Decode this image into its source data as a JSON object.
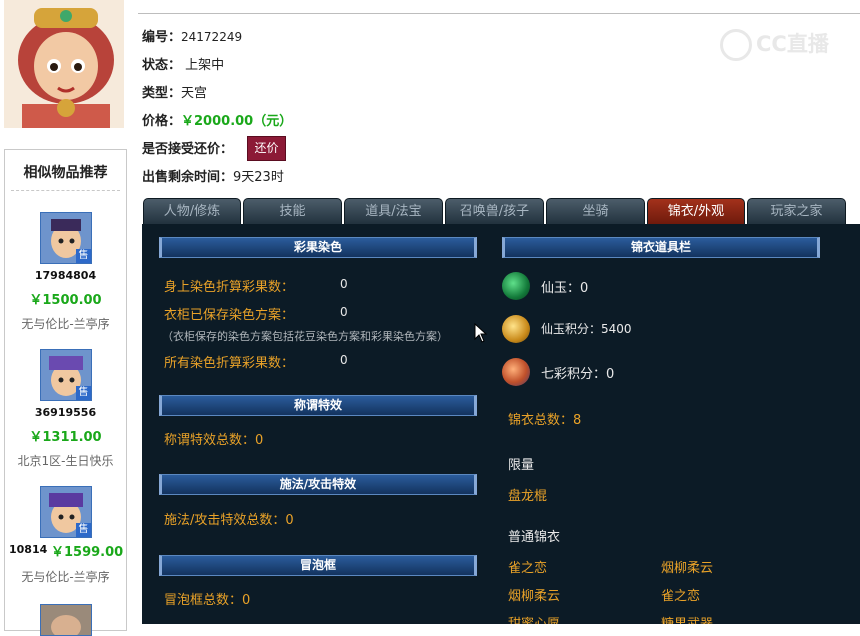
{
  "item": {
    "id_label": "编号：",
    "id": "24172249",
    "status_label": "状态：",
    "status": "上架中",
    "type_label": "类型：",
    "type": "天宫",
    "price_label": "价格：",
    "price": "￥2000.00（元）",
    "bargain_label": "是否接受还价：",
    "bargain_button": "还价",
    "remaining_label": "出售剩余时间：",
    "remaining": "9天23时"
  },
  "watermark": "CC直播",
  "similar": {
    "title": "相似物品推荐",
    "sell_badge": "售",
    "items": [
      {
        "id": "17984804",
        "price": "￥1500.00",
        "server": "无与伦比-兰亭序"
      },
      {
        "id": "36919556",
        "price": "￥1311.00",
        "server": "北京1区-生日快乐"
      },
      {
        "id": "10814",
        "price": "￥1599.00",
        "server": "无与伦比-兰亭序"
      }
    ]
  },
  "tabs": [
    "人物/修炼",
    "技能",
    "道具/法宝",
    "召唤兽/孩子",
    "坐骑",
    "锦衣/外观",
    "玩家之家"
  ],
  "active_tab": "锦衣/外观",
  "dye": {
    "header": "彩果染色",
    "body_label": "身上染色折算彩果数：",
    "body_value": "0",
    "wardrobe_label": "衣柜已保存染色方案：",
    "wardrobe_value": "0",
    "note": "（衣柜保存的染色方案包括花豆染色方案和彩果染色方案）",
    "total_label": "所有染色折算彩果数：",
    "total_value": "0"
  },
  "title_effect": {
    "header": "称谓特效",
    "label": "称谓特效总数：0"
  },
  "spell_effect": {
    "header": "施法/攻击特效",
    "label": "施法/攻击特效总数：0"
  },
  "bubble": {
    "header": "冒泡框",
    "label": "冒泡框总数：0"
  },
  "outfit": {
    "header": "锦衣道具栏",
    "xianyu": "仙玉：0",
    "xianyu_points": "仙玉积分：5400",
    "rainbow_points": "七彩积分：0",
    "total": "锦衣总数：8",
    "limited_label": "限量",
    "limited_items": [
      "盘龙棍"
    ],
    "normal_label": "普通锦衣",
    "normal_items": [
      "雀之恋",
      "烟柳柔云",
      "烟柳柔云",
      "雀之恋",
      "甜蜜心愿",
      "糖果武器"
    ]
  },
  "colors": {
    "accent_green": "#1aa81a",
    "panel_bg": "#0c1b26",
    "label_gold": "#e9a228",
    "active_tab": "#a3311b"
  }
}
